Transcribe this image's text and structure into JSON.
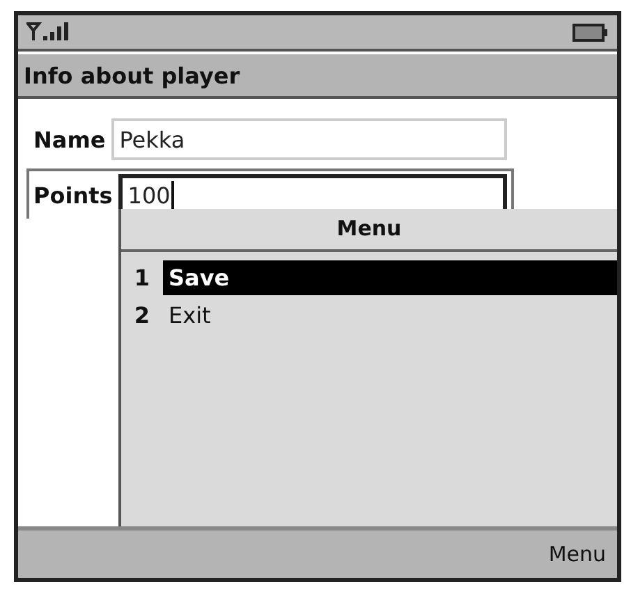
{
  "screen_title": "Info about player",
  "fields": [
    {
      "label": "Name",
      "value": "Pekka",
      "focused": false
    },
    {
      "label": "Points",
      "value": "100",
      "focused": true
    }
  ],
  "menu": {
    "title": "Menu",
    "items": [
      {
        "number": "1",
        "label": "Save",
        "selected": true
      },
      {
        "number": "2",
        "label": "Exit",
        "selected": false
      }
    ]
  },
  "soft_keys": [
    {
      "label": "Menu"
    }
  ]
}
